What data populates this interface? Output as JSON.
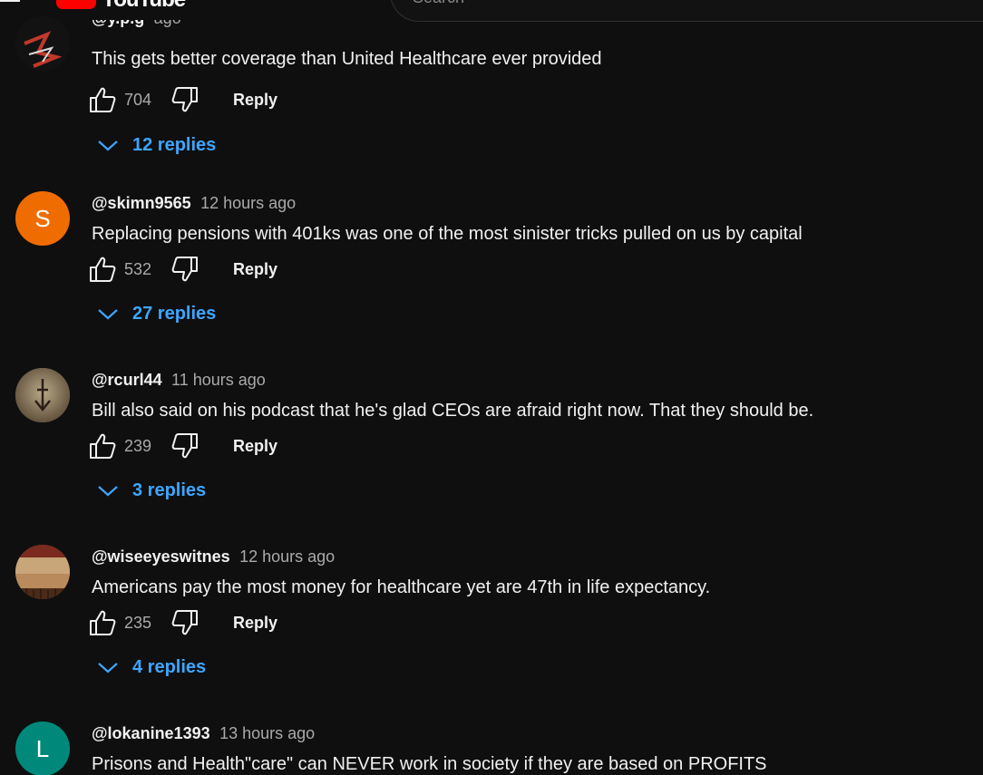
{
  "header": {
    "logo_text": "YouTube",
    "search_placeholder": "Search"
  },
  "comments": [
    {
      "author": "@y.p.g",
      "time": "ago",
      "text": "This gets better coverage than United Healthcare ever provided",
      "likes": "704",
      "reply_label": "Reply",
      "replies_label": "12 replies",
      "avatar_letter": "",
      "avatar_color": "#1a1a1a"
    },
    {
      "author": "@skimn9565",
      "time": "12 hours ago",
      "text": "Replacing pensions with 401ks was one of the most sinister tricks pulled on us by capital",
      "likes": "532",
      "reply_label": "Reply",
      "replies_label": "27 replies",
      "avatar_letter": "S",
      "avatar_color": "#ef6c00"
    },
    {
      "author": "@rcurl44",
      "time": "11 hours ago",
      "text": "Bill also said on his podcast that he's glad CEOs are afraid right now. That they should be.",
      "likes": "239",
      "reply_label": "Reply",
      "replies_label": "3 replies",
      "avatar_letter": "",
      "avatar_color": "#8a7a62"
    },
    {
      "author": "@wiseeyeswitnes",
      "time": "12 hours ago",
      "text": "Americans pay the most money for healthcare yet are 47th in life expectancy.",
      "likes": "235",
      "reply_label": "Reply",
      "replies_label": "4 replies",
      "avatar_letter": "",
      "avatar_color": "#8f5e3a"
    },
    {
      "author": "@lokanine1393",
      "time": "13 hours ago",
      "text": "Prisons and Health\"care\" can NEVER work in society if they are based on PROFITS",
      "likes": "",
      "reply_label": "Reply",
      "replies_label": "",
      "avatar_letter": "L",
      "avatar_color": "#00897b"
    }
  ]
}
